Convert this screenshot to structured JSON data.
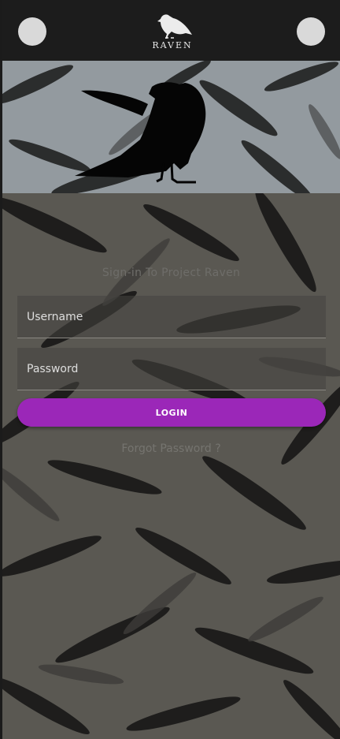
{
  "header": {
    "logo_text": "RAVEN",
    "left_button_icon": "circle-icon",
    "right_button_icon": "circle-icon"
  },
  "form": {
    "title": "Sign-in To Project Raven",
    "username_placeholder": "Username",
    "password_placeholder": "Password",
    "login_label": "LOGIN",
    "forgot_label": "Forgot Password ?"
  },
  "colors": {
    "topbar": "#1c1c1c",
    "hero": "#939a9f",
    "background": "#5a5852",
    "accent": "#9b27b8"
  }
}
